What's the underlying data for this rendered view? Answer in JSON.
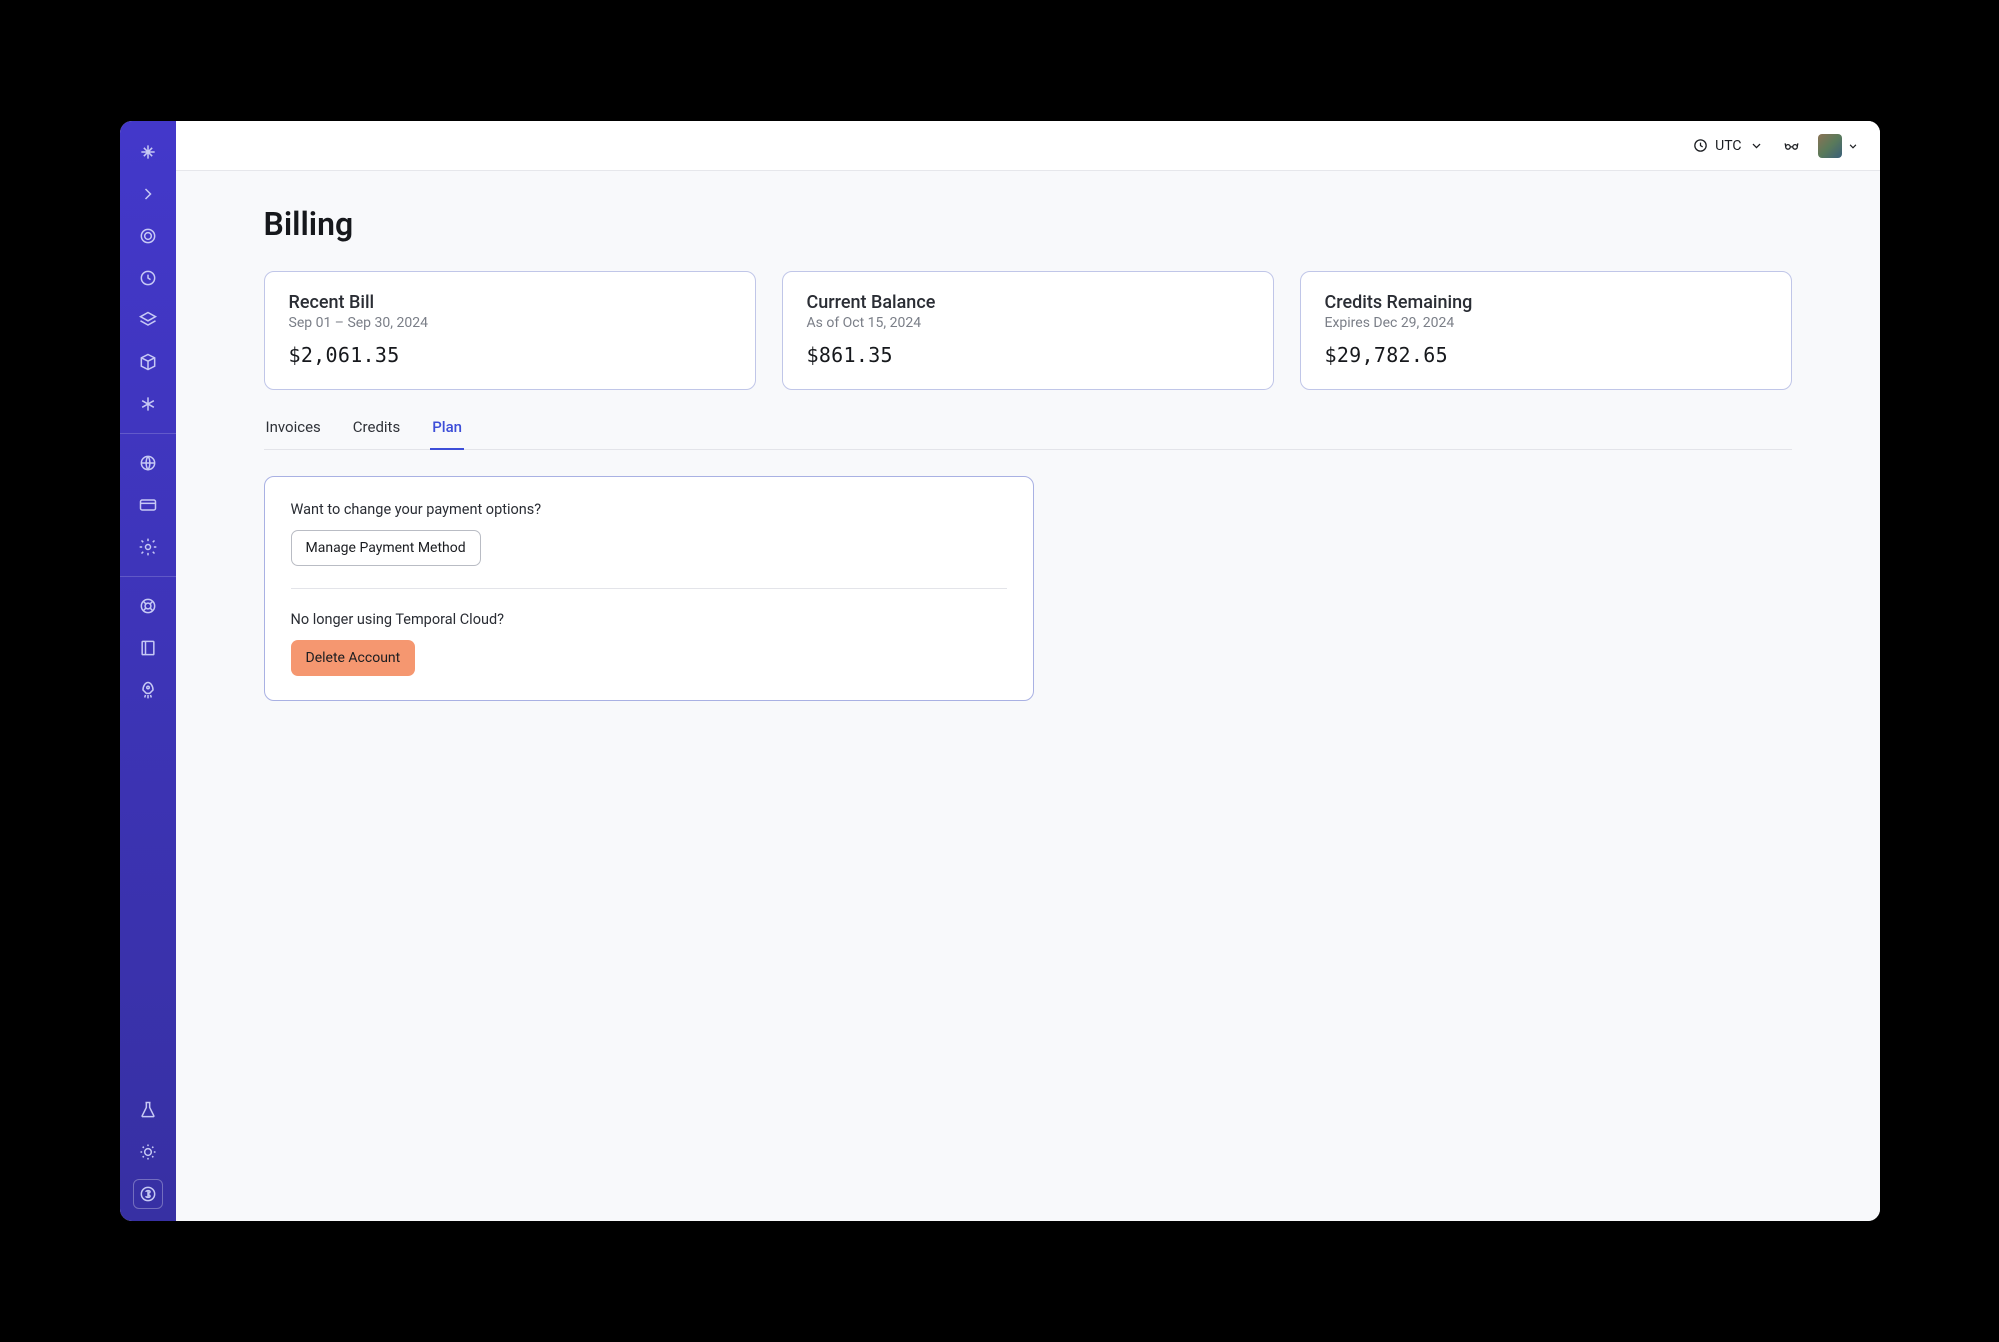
{
  "sidebar": {
    "icons_top": [
      "logo",
      "chevron-right",
      "target",
      "clock",
      "layers",
      "cube",
      "asterisk"
    ],
    "icons_mid": [
      "globe",
      "credit-card",
      "gear"
    ],
    "icons_low": [
      "life-ring",
      "book",
      "rocket"
    ],
    "icons_bottom": [
      "flask",
      "sun",
      "dollar-circle"
    ]
  },
  "topbar": {
    "timezone": "UTC"
  },
  "page": {
    "title": "Billing"
  },
  "cards": [
    {
      "title": "Recent Bill",
      "sub": "Sep 01 – Sep 30, 2024",
      "amount": "$2,061.35"
    },
    {
      "title": "Current Balance",
      "sub": "As of Oct 15, 2024",
      "amount": "$861.35"
    },
    {
      "title": "Credits Remaining",
      "sub": "Expires Dec 29, 2024",
      "amount": "$29,782.65"
    }
  ],
  "tabs": [
    {
      "label": "Invoices",
      "active": false
    },
    {
      "label": "Credits",
      "active": false
    },
    {
      "label": "Plan",
      "active": true
    }
  ],
  "plan": {
    "payment_prompt": "Want to change your payment options?",
    "manage_button": "Manage Payment Method",
    "delete_prompt": "No longer using Temporal Cloud?",
    "delete_button": "Delete Account"
  }
}
